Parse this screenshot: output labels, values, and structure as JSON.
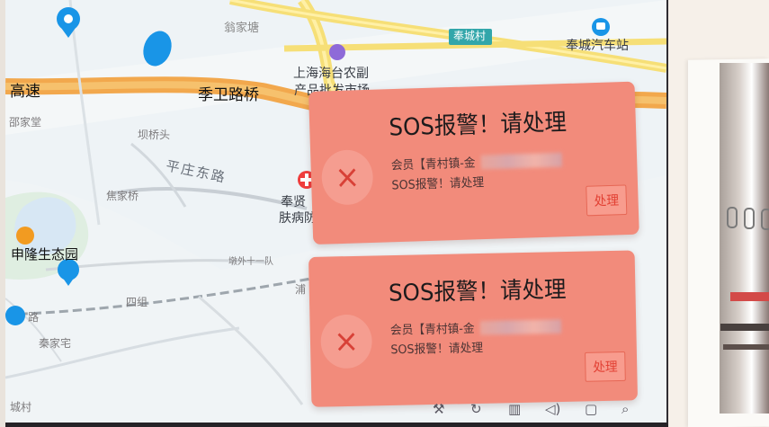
{
  "map": {
    "labels": {
      "top_village": "翁家塘",
      "fengcheng_village": "奉城村",
      "bus_station": "奉城汽车站",
      "shanghai_market_line1": "上海海台农副",
      "shanghai_market_line2": "产品批发市场",
      "jiweilu_bridge": "季卫路桥",
      "expressway": "高速",
      "left_house": "邵家堂",
      "jianqiao_head": "坝桥头",
      "pingzhuang_road": "平庄东路",
      "jiaojiaqiao": "焦家桥",
      "fengxian_line1": "奉贤",
      "fengxian_line2": "肤病防",
      "shenlong_garden": "申隆生态园",
      "dun_team": "墩外十一队",
      "group_four": "四组",
      "qinjiazhai": "秦家宅",
      "city_village": "城村",
      "road_short": "路",
      "pu_road": "浦",
      "road_mark": "路"
    },
    "colors": {
      "background": "#eef3f6",
      "major_road": "#f2a84d",
      "yellow_road": "#f6df77",
      "water": "#d7e7f4",
      "park": "#dfeee1",
      "poi_blue": "#1995e7",
      "poi_purple": "#8e6ad8"
    }
  },
  "alarms": [
    {
      "title": "SOS报警！请处理",
      "member_prefix": "会员【青村镇-金",
      "message": "SOS报警！请处理",
      "action": "处理"
    },
    {
      "title": "SOS报警！请处理",
      "member_prefix": "会员【青村镇-金",
      "message": "SOS报警！请处理",
      "action": "处理"
    }
  ],
  "toolbar": {
    "icons": [
      "wrench-icon",
      "refresh-icon",
      "trash-icon",
      "volume-icon",
      "window-icon",
      "search-icon"
    ],
    "glyphs": [
      "⚒",
      "↻",
      "▥",
      "◁)",
      "▢",
      "⌕"
    ]
  },
  "alarm_colors": {
    "card": "#f28b7b",
    "button_text": "#e24134",
    "close_icon": "#d84137"
  }
}
